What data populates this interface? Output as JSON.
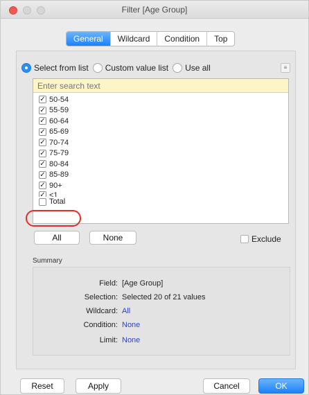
{
  "window": {
    "title": "Filter [Age Group]"
  },
  "tabs": [
    {
      "label": "General",
      "active": true
    },
    {
      "label": "Wildcard",
      "active": false
    },
    {
      "label": "Condition",
      "active": false
    },
    {
      "label": "Top",
      "active": false
    }
  ],
  "mode": {
    "options": [
      {
        "label": "Select from list",
        "selected": true
      },
      {
        "label": "Custom value list",
        "selected": false
      },
      {
        "label": "Use all",
        "selected": false
      }
    ]
  },
  "list": {
    "search_placeholder": "Enter search text",
    "items": [
      {
        "label": "50-54",
        "checked": true
      },
      {
        "label": "55-59",
        "checked": true
      },
      {
        "label": "60-64",
        "checked": true
      },
      {
        "label": "65-69",
        "checked": true
      },
      {
        "label": "70-74",
        "checked": true
      },
      {
        "label": "75-79",
        "checked": true
      },
      {
        "label": "80-84",
        "checked": true
      },
      {
        "label": "85-89",
        "checked": true
      },
      {
        "label": "90+",
        "checked": true
      },
      {
        "label": "<1",
        "checked": true
      },
      {
        "label": "Total",
        "checked": false
      }
    ]
  },
  "buttons": {
    "all": "All",
    "none": "None",
    "exclude": "Exclude"
  },
  "summary": {
    "heading": "Summary",
    "rows": [
      {
        "key": "Field:",
        "value": "[Age Group]",
        "link": false
      },
      {
        "key": "Selection:",
        "value": "Selected 20 of 21 values",
        "link": false
      },
      {
        "key": "Wildcard:",
        "value": "All",
        "link": true
      },
      {
        "key": "Condition:",
        "value": "None",
        "link": true
      },
      {
        "key": "Limit:",
        "value": "None",
        "link": true
      }
    ]
  },
  "footer": {
    "reset": "Reset",
    "apply": "Apply",
    "cancel": "Cancel",
    "ok": "OK"
  },
  "colors": {
    "accent": "#1a82fb",
    "highlight_ring": "#e42b26",
    "link": "#2a3fd0",
    "search_bg": "#fbf5c8"
  }
}
